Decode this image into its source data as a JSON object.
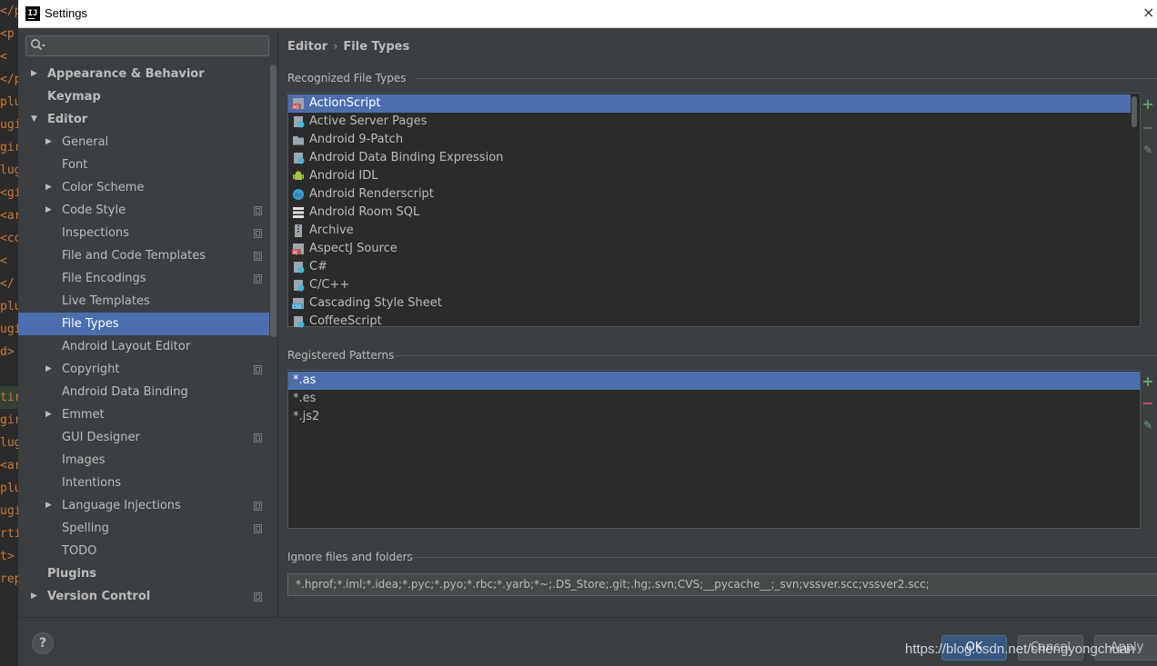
{
  "window": {
    "title": "Settings"
  },
  "background_editor": {
    "lines": [
      "</p",
      "<p",
      "<",
      "</p",
      "plu",
      "ugi",
      "gir",
      "lug",
      "<gi",
      "<ar",
      "<co",
      "<",
      "</",
      "plu",
      "ugi",
      "d>",
      "",
      "tir",
      "gir",
      "lug",
      "<ar",
      "plu",
      "ugi",
      "rti",
      "t>",
      "rep"
    ]
  },
  "sidebar": {
    "search_placeholder": "",
    "items": [
      {
        "label": "Appearance & Behavior",
        "level": 0,
        "arrow": "right",
        "bold": true,
        "copy": false
      },
      {
        "label": "Keymap",
        "level": 0,
        "arrow": "",
        "bold": true,
        "copy": false
      },
      {
        "label": "Editor",
        "level": 0,
        "arrow": "down",
        "bold": true,
        "copy": false
      },
      {
        "label": "General",
        "level": 1,
        "arrow": "right",
        "bold": false,
        "copy": false
      },
      {
        "label": "Font",
        "level": 1,
        "arrow": "",
        "bold": false,
        "copy": false
      },
      {
        "label": "Color Scheme",
        "level": 1,
        "arrow": "right",
        "bold": false,
        "copy": false
      },
      {
        "label": "Code Style",
        "level": 1,
        "arrow": "right",
        "bold": false,
        "copy": true
      },
      {
        "label": "Inspections",
        "level": 1,
        "arrow": "",
        "bold": false,
        "copy": true
      },
      {
        "label": "File and Code Templates",
        "level": 1,
        "arrow": "",
        "bold": false,
        "copy": true
      },
      {
        "label": "File Encodings",
        "level": 1,
        "arrow": "",
        "bold": false,
        "copy": true
      },
      {
        "label": "Live Templates",
        "level": 1,
        "arrow": "",
        "bold": false,
        "copy": false
      },
      {
        "label": "File Types",
        "level": 1,
        "arrow": "",
        "bold": false,
        "copy": false,
        "selected": true
      },
      {
        "label": "Android Layout Editor",
        "level": 1,
        "arrow": "",
        "bold": false,
        "copy": false
      },
      {
        "label": "Copyright",
        "level": 1,
        "arrow": "right",
        "bold": false,
        "copy": true
      },
      {
        "label": "Android Data Binding",
        "level": 1,
        "arrow": "",
        "bold": false,
        "copy": false
      },
      {
        "label": "Emmet",
        "level": 1,
        "arrow": "right",
        "bold": false,
        "copy": false
      },
      {
        "label": "GUI Designer",
        "level": 1,
        "arrow": "",
        "bold": false,
        "copy": true
      },
      {
        "label": "Images",
        "level": 1,
        "arrow": "",
        "bold": false,
        "copy": false
      },
      {
        "label": "Intentions",
        "level": 1,
        "arrow": "",
        "bold": false,
        "copy": false
      },
      {
        "label": "Language Injections",
        "level": 1,
        "arrow": "right",
        "bold": false,
        "copy": true
      },
      {
        "label": "Spelling",
        "level": 1,
        "arrow": "",
        "bold": false,
        "copy": true
      },
      {
        "label": "TODO",
        "level": 1,
        "arrow": "",
        "bold": false,
        "copy": false
      },
      {
        "label": "Plugins",
        "level": 0,
        "arrow": "",
        "bold": true,
        "copy": false
      },
      {
        "label": "Version Control",
        "level": 0,
        "arrow": "right",
        "bold": true,
        "copy": true
      }
    ]
  },
  "breadcrumb": {
    "parent": "Editor",
    "separator": "›",
    "current": "File Types"
  },
  "recognized": {
    "title": "Recognized File Types",
    "items": [
      {
        "label": "ActionScript",
        "icon": "actionscript-icon",
        "selected": true
      },
      {
        "label": "Active Server Pages",
        "icon": "asp-icon"
      },
      {
        "label": "Android 9-Patch",
        "icon": "folder-icon"
      },
      {
        "label": "Android Data Binding Expression",
        "icon": "data-binding-icon"
      },
      {
        "label": "Android IDL",
        "icon": "android-icon"
      },
      {
        "label": "Android Renderscript",
        "icon": "renderscript-icon"
      },
      {
        "label": "Android Room SQL",
        "icon": "sql-icon"
      },
      {
        "label": "Archive",
        "icon": "archive-icon"
      },
      {
        "label": "AspectJ Source",
        "icon": "aspectj-icon"
      },
      {
        "label": "C#",
        "icon": "csharp-icon"
      },
      {
        "label": "C/C++",
        "icon": "cpp-icon"
      },
      {
        "label": "Cascading Style Sheet",
        "icon": "css-icon"
      },
      {
        "label": "CoffeeScript",
        "icon": "coffeescript-icon"
      }
    ]
  },
  "patterns": {
    "title": "Registered Patterns",
    "items": [
      {
        "label": "*.as",
        "selected": true
      },
      {
        "label": "*.es"
      },
      {
        "label": "*.js2"
      }
    ]
  },
  "ignore": {
    "title": "Ignore files and folders",
    "value": "*.hprof;*.iml;*.idea;*.pyc;*.pyo;*.rbc;*.yarb;*~;.DS_Store;.git;.hg;.svn;CVS;__pycache__;_svn;vssver.scc;vssver2.scc;"
  },
  "footer": {
    "help": "?",
    "ok": "OK",
    "cancel": "Cancel",
    "apply": "Apply",
    "watermark": "https://blog.csdn.net/chengyongchuan"
  },
  "colors": {
    "selection": "#4b6eaf",
    "background": "#3c3f41",
    "list_bg": "#2b2b2b",
    "add": "#59a869",
    "remove": "#c75450"
  }
}
